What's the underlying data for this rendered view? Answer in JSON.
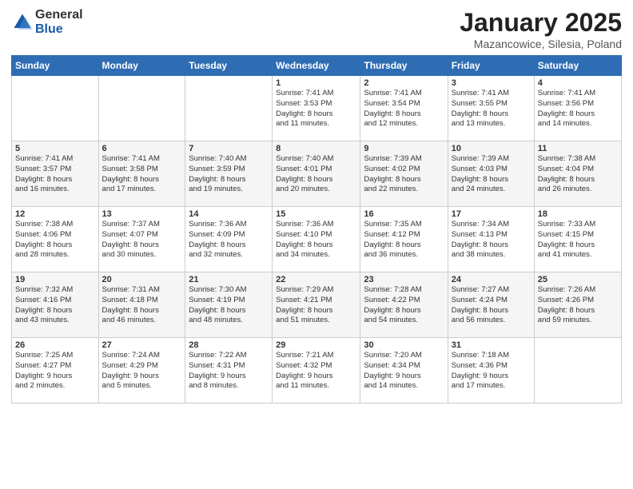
{
  "header": {
    "logo_general": "General",
    "logo_blue": "Blue",
    "month_title": "January 2025",
    "location": "Mazancowice, Silesia, Poland"
  },
  "weekdays": [
    "Sunday",
    "Monday",
    "Tuesday",
    "Wednesday",
    "Thursday",
    "Friday",
    "Saturday"
  ],
  "weeks": [
    [
      {
        "day": "",
        "info": ""
      },
      {
        "day": "",
        "info": ""
      },
      {
        "day": "",
        "info": ""
      },
      {
        "day": "1",
        "info": "Sunrise: 7:41 AM\nSunset: 3:53 PM\nDaylight: 8 hours\nand 11 minutes."
      },
      {
        "day": "2",
        "info": "Sunrise: 7:41 AM\nSunset: 3:54 PM\nDaylight: 8 hours\nand 12 minutes."
      },
      {
        "day": "3",
        "info": "Sunrise: 7:41 AM\nSunset: 3:55 PM\nDaylight: 8 hours\nand 13 minutes."
      },
      {
        "day": "4",
        "info": "Sunrise: 7:41 AM\nSunset: 3:56 PM\nDaylight: 8 hours\nand 14 minutes."
      }
    ],
    [
      {
        "day": "5",
        "info": "Sunrise: 7:41 AM\nSunset: 3:57 PM\nDaylight: 8 hours\nand 16 minutes."
      },
      {
        "day": "6",
        "info": "Sunrise: 7:41 AM\nSunset: 3:58 PM\nDaylight: 8 hours\nand 17 minutes."
      },
      {
        "day": "7",
        "info": "Sunrise: 7:40 AM\nSunset: 3:59 PM\nDaylight: 8 hours\nand 19 minutes."
      },
      {
        "day": "8",
        "info": "Sunrise: 7:40 AM\nSunset: 4:01 PM\nDaylight: 8 hours\nand 20 minutes."
      },
      {
        "day": "9",
        "info": "Sunrise: 7:39 AM\nSunset: 4:02 PM\nDaylight: 8 hours\nand 22 minutes."
      },
      {
        "day": "10",
        "info": "Sunrise: 7:39 AM\nSunset: 4:03 PM\nDaylight: 8 hours\nand 24 minutes."
      },
      {
        "day": "11",
        "info": "Sunrise: 7:38 AM\nSunset: 4:04 PM\nDaylight: 8 hours\nand 26 minutes."
      }
    ],
    [
      {
        "day": "12",
        "info": "Sunrise: 7:38 AM\nSunset: 4:06 PM\nDaylight: 8 hours\nand 28 minutes."
      },
      {
        "day": "13",
        "info": "Sunrise: 7:37 AM\nSunset: 4:07 PM\nDaylight: 8 hours\nand 30 minutes."
      },
      {
        "day": "14",
        "info": "Sunrise: 7:36 AM\nSunset: 4:09 PM\nDaylight: 8 hours\nand 32 minutes."
      },
      {
        "day": "15",
        "info": "Sunrise: 7:36 AM\nSunset: 4:10 PM\nDaylight: 8 hours\nand 34 minutes."
      },
      {
        "day": "16",
        "info": "Sunrise: 7:35 AM\nSunset: 4:12 PM\nDaylight: 8 hours\nand 36 minutes."
      },
      {
        "day": "17",
        "info": "Sunrise: 7:34 AM\nSunset: 4:13 PM\nDaylight: 8 hours\nand 38 minutes."
      },
      {
        "day": "18",
        "info": "Sunrise: 7:33 AM\nSunset: 4:15 PM\nDaylight: 8 hours\nand 41 minutes."
      }
    ],
    [
      {
        "day": "19",
        "info": "Sunrise: 7:32 AM\nSunset: 4:16 PM\nDaylight: 8 hours\nand 43 minutes."
      },
      {
        "day": "20",
        "info": "Sunrise: 7:31 AM\nSunset: 4:18 PM\nDaylight: 8 hours\nand 46 minutes."
      },
      {
        "day": "21",
        "info": "Sunrise: 7:30 AM\nSunset: 4:19 PM\nDaylight: 8 hours\nand 48 minutes."
      },
      {
        "day": "22",
        "info": "Sunrise: 7:29 AM\nSunset: 4:21 PM\nDaylight: 8 hours\nand 51 minutes."
      },
      {
        "day": "23",
        "info": "Sunrise: 7:28 AM\nSunset: 4:22 PM\nDaylight: 8 hours\nand 54 minutes."
      },
      {
        "day": "24",
        "info": "Sunrise: 7:27 AM\nSunset: 4:24 PM\nDaylight: 8 hours\nand 56 minutes."
      },
      {
        "day": "25",
        "info": "Sunrise: 7:26 AM\nSunset: 4:26 PM\nDaylight: 8 hours\nand 59 minutes."
      }
    ],
    [
      {
        "day": "26",
        "info": "Sunrise: 7:25 AM\nSunset: 4:27 PM\nDaylight: 9 hours\nand 2 minutes."
      },
      {
        "day": "27",
        "info": "Sunrise: 7:24 AM\nSunset: 4:29 PM\nDaylight: 9 hours\nand 5 minutes."
      },
      {
        "day": "28",
        "info": "Sunrise: 7:22 AM\nSunset: 4:31 PM\nDaylight: 9 hours\nand 8 minutes."
      },
      {
        "day": "29",
        "info": "Sunrise: 7:21 AM\nSunset: 4:32 PM\nDaylight: 9 hours\nand 11 minutes."
      },
      {
        "day": "30",
        "info": "Sunrise: 7:20 AM\nSunset: 4:34 PM\nDaylight: 9 hours\nand 14 minutes."
      },
      {
        "day": "31",
        "info": "Sunrise: 7:18 AM\nSunset: 4:36 PM\nDaylight: 9 hours\nand 17 minutes."
      },
      {
        "day": "",
        "info": ""
      }
    ]
  ]
}
